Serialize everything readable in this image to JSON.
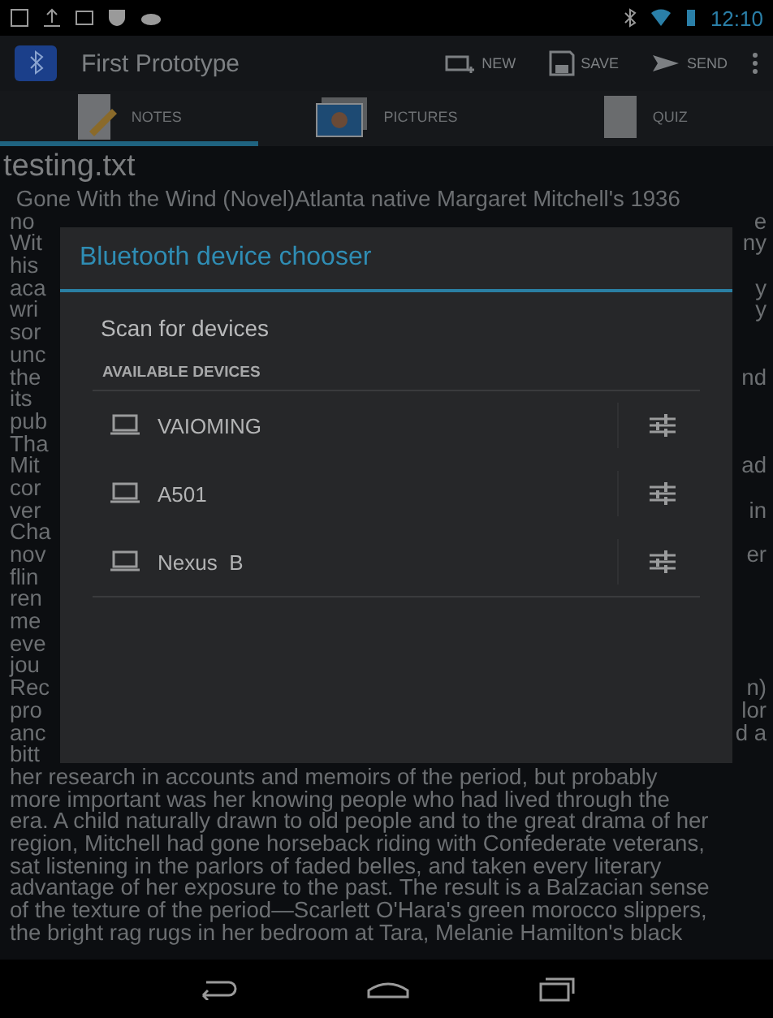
{
  "status_bar": {
    "time": "12:10"
  },
  "action_bar": {
    "title": "First Prototype",
    "actions": [
      {
        "kind": "new",
        "label": "NEW"
      },
      {
        "kind": "save",
        "label": "SAVE"
      },
      {
        "kind": "send",
        "label": "SEND"
      }
    ]
  },
  "tabs": [
    {
      "kind": "notes",
      "label": "NOTES",
      "selected": true
    },
    {
      "kind": "pictures",
      "label": "PICTURES",
      "selected": false
    },
    {
      "kind": "quiz",
      "label": "QUIZ",
      "selected": false
    }
  ],
  "document": {
    "filename": "testing.txt",
    "lines": [
      {
        "kind": "full",
        "text": " Gone With the Wind (Novel)Atlanta native Margaret Mitchell's 1936"
      },
      {
        "kind": "partial",
        "left": "no",
        "right": "e"
      },
      {
        "kind": "partial",
        "left": "Wit",
        "right": "ny"
      },
      {
        "kind": "partial",
        "left": "his"
      },
      {
        "kind": "partial",
        "left": "aca",
        "right": "y"
      },
      {
        "kind": "partial",
        "left": "wri",
        "right": "y"
      },
      {
        "kind": "partial",
        "left": "sor"
      },
      {
        "kind": "partial",
        "left": "unc"
      },
      {
        "kind": "partial",
        "left": "the",
        "right": "nd"
      },
      {
        "kind": "partial",
        "left": "its"
      },
      {
        "kind": "partial",
        "left": "pub"
      },
      {
        "kind": "partial",
        "left": "Tha"
      },
      {
        "kind": "partial",
        "left": "Mit",
        "right": "ad"
      },
      {
        "kind": "partial",
        "left": "cor"
      },
      {
        "kind": "partial",
        "left": "ver",
        "right": "in"
      },
      {
        "kind": "partial",
        "left": "Cha"
      },
      {
        "kind": "partial",
        "left": "nov",
        "right": "er"
      },
      {
        "kind": "partial",
        "left": "flin"
      },
      {
        "kind": "partial",
        "left": "ren"
      },
      {
        "kind": "partial",
        "left": "me"
      },
      {
        "kind": "partial",
        "left": "eve"
      },
      {
        "kind": "partial",
        "left": "jou"
      },
      {
        "kind": "partial",
        "left": "Rec",
        "right": "n)"
      },
      {
        "kind": "partial",
        "left": "pro",
        "right": "lor"
      },
      {
        "kind": "partial",
        "left": "anc",
        "right": "d a"
      },
      {
        "kind": "partial",
        "left": "bitt"
      },
      {
        "kind": "full",
        "text": "her research in accounts and memoirs of the period, but probably"
      },
      {
        "kind": "full",
        "text": "more important was her knowing people who had lived through the"
      },
      {
        "kind": "full",
        "text": "era. A child naturally drawn to old people and to the great drama of her"
      },
      {
        "kind": "full",
        "text": "region, Mitchell had gone horseback riding with Confederate veterans,"
      },
      {
        "kind": "full",
        "text": "sat listening in the parlors of faded belles, and taken every literary"
      },
      {
        "kind": "full",
        "text": "advantage of her exposure to the past. The result is a Balzacian sense"
      },
      {
        "kind": "full",
        "text": "of the texture of the period—Scarlett O'Hara's green morocco slippers,"
      },
      {
        "kind": "full",
        "text": "the bright rag rugs in her bedroom at Tara, Melanie Hamilton's black"
      }
    ]
  },
  "dialog": {
    "title": "Bluetooth device chooser",
    "scan_label": "Scan for devices",
    "section_header": "AVAILABLE DEVICES",
    "devices": [
      {
        "name": "VAIOMING"
      },
      {
        "name": "A501"
      },
      {
        "name": "Nexus  B"
      }
    ]
  }
}
